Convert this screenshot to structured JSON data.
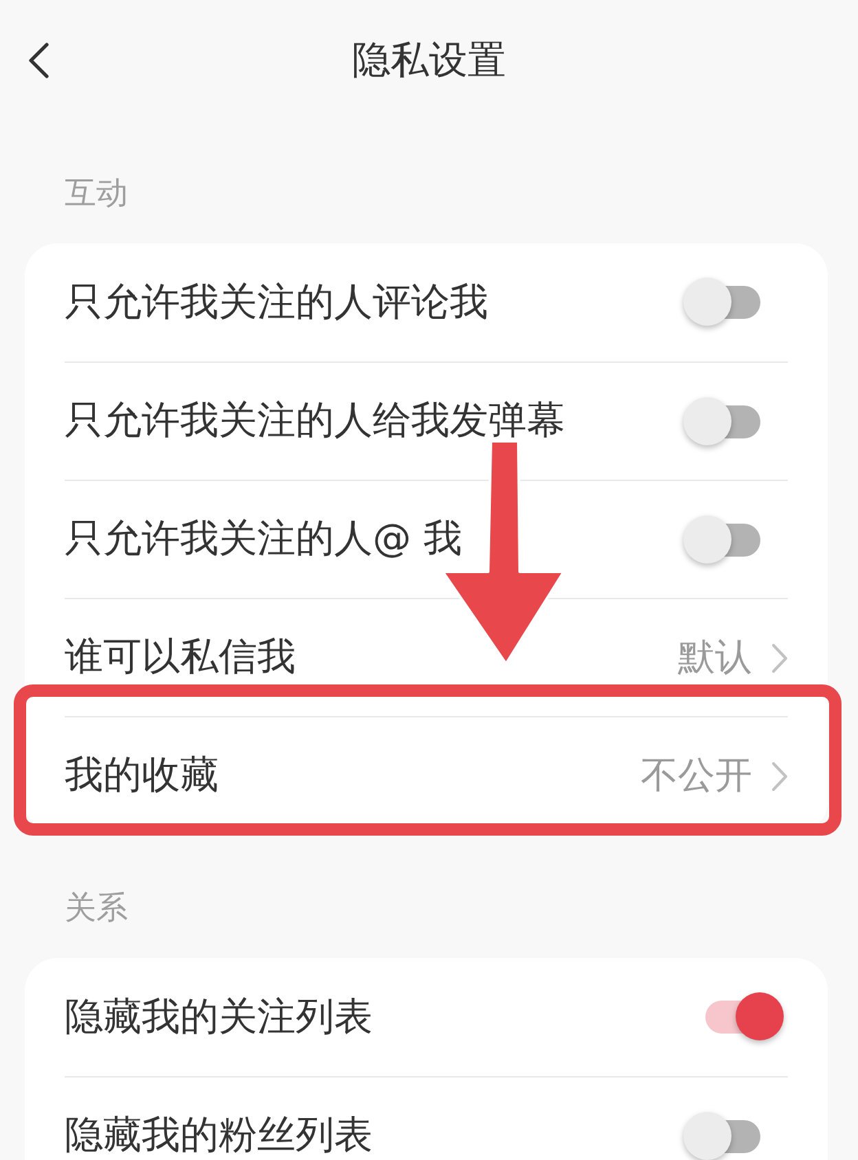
{
  "header": {
    "title": "隐私设置"
  },
  "sections": [
    {
      "title": "互动",
      "rows": [
        {
          "kind": "toggle",
          "label": "只允许我关注的人评论我",
          "on": false,
          "highlighted": false
        },
        {
          "kind": "toggle",
          "label": "只允许我关注的人给我发弹幕",
          "on": false,
          "highlighted": false
        },
        {
          "kind": "toggle",
          "label": "只允许我关注的人@ 我",
          "on": false,
          "highlighted": false
        },
        {
          "kind": "link",
          "label": "谁可以私信我",
          "value": "默认",
          "highlighted": false
        },
        {
          "kind": "link",
          "label": "我的收藏",
          "value": "不公开",
          "highlighted": true
        }
      ]
    },
    {
      "title": "关系",
      "rows": [
        {
          "kind": "toggle",
          "label": "隐藏我的关注列表",
          "on": true,
          "highlighted": false
        },
        {
          "kind": "toggle",
          "label": "隐藏我的粉丝列表",
          "on": false,
          "highlighted": false
        }
      ]
    }
  ],
  "annotations": [
    {
      "kind": "down_arrow"
    }
  ]
}
